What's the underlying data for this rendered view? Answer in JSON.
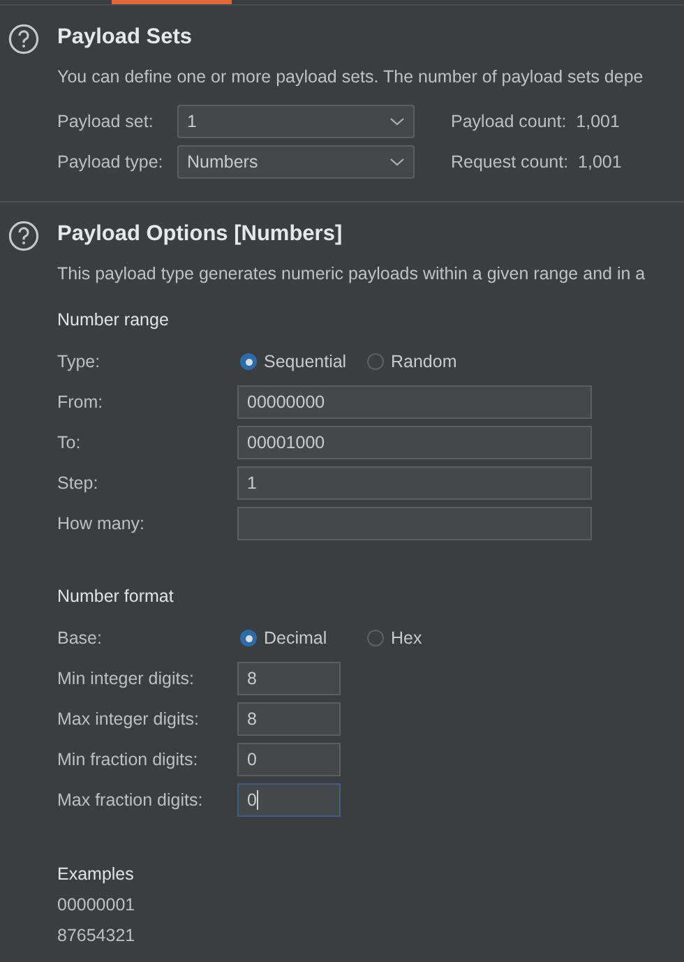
{
  "tabs_strip": {
    "selected_indicator": true
  },
  "payload_sets": {
    "title": "Payload Sets",
    "description": "You can define one or more payload sets. The number of payload sets depe",
    "fields": [
      {
        "label": "Payload set:",
        "value": "1"
      },
      {
        "label": "Payload type:",
        "value": "Numbers"
      }
    ],
    "counts": [
      {
        "label": "Payload count:",
        "value": "1,001"
      },
      {
        "label": "Request count:",
        "value": "1,001"
      }
    ]
  },
  "payload_options": {
    "title": "Payload Options [Numbers]",
    "description": "This payload type generates numeric payloads within a given range and in a",
    "number_range": {
      "heading": "Number range",
      "rows": [
        {
          "kind": "radio",
          "label": "Type:",
          "options": [
            {
              "label": "Sequential",
              "selected": true
            },
            {
              "label": "Random",
              "selected": false
            }
          ]
        },
        {
          "kind": "field",
          "label": "From:",
          "value": "00000000",
          "focused": false
        },
        {
          "kind": "field",
          "label": "To:",
          "value": "00001000",
          "focused": false
        },
        {
          "kind": "field",
          "label": "Step:",
          "value": "1",
          "focused": false
        },
        {
          "kind": "field",
          "label": "How many:",
          "focused": false
        }
      ]
    },
    "number_format": {
      "heading": "Number format",
      "rows": [
        {
          "kind": "radio",
          "label": "Base:",
          "options": [
            {
              "label": "Decimal",
              "selected": true
            },
            {
              "label": "Hex",
              "selected": false
            }
          ]
        },
        {
          "kind": "field",
          "label": "Min integer digits:",
          "value": "8",
          "focused": false
        },
        {
          "kind": "field",
          "label": "Max integer digits:",
          "value": "8",
          "focused": false
        },
        {
          "kind": "field",
          "label": "Min fraction digits:",
          "value": "0",
          "focused": false
        },
        {
          "kind": "field",
          "label": "Max fraction digits:",
          "value": "0",
          "focused": true
        }
      ]
    },
    "examples": {
      "heading": "Examples",
      "values": [
        "00000001",
        "87654321"
      ]
    }
  }
}
